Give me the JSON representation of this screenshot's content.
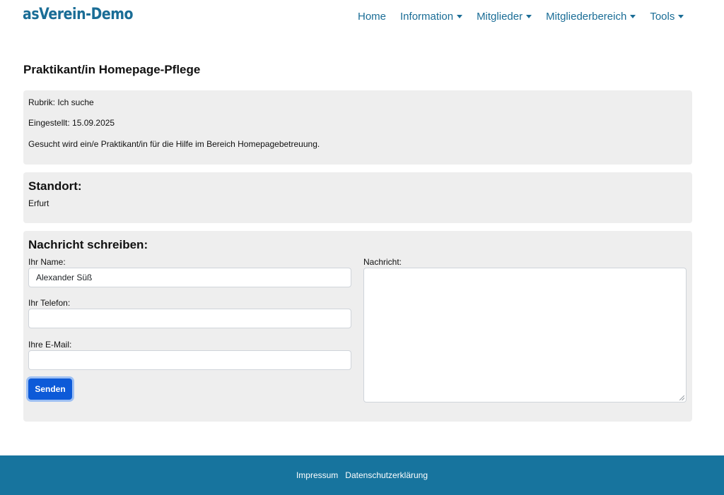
{
  "brand": "asVerein-Demo",
  "nav": {
    "items": [
      {
        "label": "Home",
        "dropdown": false
      },
      {
        "label": "Information",
        "dropdown": true
      },
      {
        "label": "Mitglieder",
        "dropdown": true
      },
      {
        "label": "Mitgliederbereich",
        "dropdown": true
      },
      {
        "label": "Tools",
        "dropdown": true
      }
    ]
  },
  "page_title": "Praktikant/in Homepage-Pflege",
  "info": {
    "rubrik": "Rubrik: Ich suche",
    "eingestellt": "Eingestellt: 15.09.2025",
    "description": "Gesucht wird ein/e Praktikant/in für die Hilfe im Bereich Homepagebetreuung."
  },
  "standort": {
    "heading": "Standort:",
    "value": "Erfurt"
  },
  "message_form": {
    "heading": "Nachricht schreiben:",
    "name_label": "Ihr Name:",
    "name_value": "Alexander Süß",
    "phone_label": "Ihr Telefon:",
    "phone_value": "",
    "email_label": "Ihre E-Mail:",
    "email_value": "",
    "message_label": "Nachricht:",
    "message_value": "",
    "send_label": "Senden"
  },
  "footer": {
    "impressum": "Impressum",
    "datenschutz": "Datenschutzerklärung"
  },
  "colors": {
    "brand": "#1a6d96",
    "footer_bg": "#17749e",
    "card_bg": "#eeeeee",
    "button": "#0d5ad8"
  }
}
